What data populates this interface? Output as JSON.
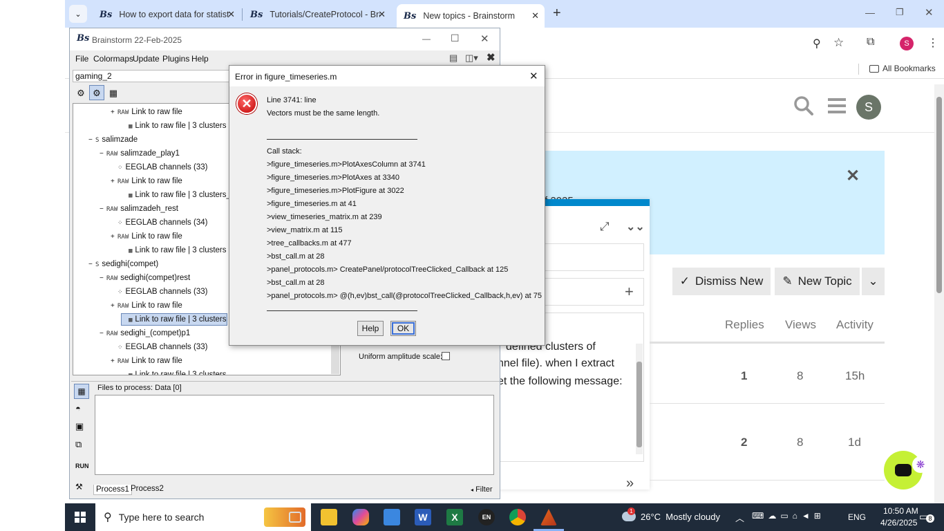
{
  "browser": {
    "tabs": [
      {
        "title": "How to export data for statistic",
        "favicon": "Bs"
      },
      {
        "title": "Tutorials/CreateProtocol - Brain",
        "favicon": "Bs"
      },
      {
        "title": "New topics - Brainstorm",
        "favicon": "Bs"
      }
    ],
    "new_tab": "+",
    "bookmarks_label": "All Bookmarks",
    "profile_initial": "S"
  },
  "forum": {
    "avatar_initial": "S",
    "banner_fragment": "f 2025",
    "dismiss_label": "Dismiss New",
    "new_topic_label": "New Topic",
    "columns": [
      "Replies",
      "Views",
      "Activity"
    ],
    "rows": [
      {
        "replies": "1",
        "views": "8",
        "activity": "15h"
      },
      {
        "replies": "2",
        "views": "8",
        "activity": "1d"
      }
    ],
    "composer_text": [
      "defined clusters of",
      "nnel file). when I extract",
      "et the following message:"
    ],
    "composer_plus": "+"
  },
  "brainstorm": {
    "title": "Brainstorm 22-Feb-2025",
    "menu": [
      "File",
      "Colormaps",
      "Update",
      "Plugins",
      "Help"
    ],
    "protocol": "gaming_2",
    "tree": [
      {
        "indent": 3,
        "icon": "RAW",
        "label": "Link to raw file",
        "expand": "+"
      },
      {
        "indent": 4,
        "icon": "▦",
        "label": "Link to raw file | 3 clusters"
      },
      {
        "indent": 1,
        "icon": "S",
        "label": "salimzade",
        "expand": "−"
      },
      {
        "indent": 2,
        "icon": "RAW",
        "label": "salimzade_play1",
        "expand": "−"
      },
      {
        "indent": 3,
        "icon": "⁘",
        "label": "EEGLAB channels (33)"
      },
      {
        "indent": 3,
        "icon": "RAW",
        "label": "Link to raw file",
        "expand": "+"
      },
      {
        "indent": 4,
        "icon": "▦",
        "label": "Link to raw file | 3 clusters_02"
      },
      {
        "indent": 2,
        "icon": "RAW",
        "label": "salimzadeh_rest",
        "expand": "−"
      },
      {
        "indent": 3,
        "icon": "⁘",
        "label": "EEGLAB channels (34)"
      },
      {
        "indent": 3,
        "icon": "RAW",
        "label": "Link to raw file",
        "expand": "+"
      },
      {
        "indent": 4,
        "icon": "▦",
        "label": "Link to raw file | 3 clusters"
      },
      {
        "indent": 1,
        "icon": "S",
        "label": "sedighi(compet)",
        "expand": "−"
      },
      {
        "indent": 2,
        "icon": "RAW",
        "label": "sedighi(compet)rest",
        "expand": "−"
      },
      {
        "indent": 3,
        "icon": "⁘",
        "label": "EEGLAB channels (33)"
      },
      {
        "indent": 3,
        "icon": "RAW",
        "label": "Link to raw file",
        "expand": "+"
      },
      {
        "indent": 4,
        "icon": "▦",
        "label": "Link to raw file | 3 clusters",
        "selected": true
      },
      {
        "indent": 2,
        "icon": "RAW",
        "label": "sedighi_(compet)p1",
        "expand": "−"
      },
      {
        "indent": 3,
        "icon": "⁘",
        "label": "EEGLAB channels (33)"
      },
      {
        "indent": 3,
        "icon": "RAW",
        "label": "Link to raw file",
        "expand": "+"
      },
      {
        "indent": 4,
        "icon": "▦",
        "label": "Link to raw file | 3 clusters"
      }
    ],
    "uniform_label": "Uniform amplitude scale:",
    "files_label": "Files to process: Data [0]",
    "process_tabs": [
      "Process1",
      "Process2"
    ],
    "filter_label": "Filter",
    "run_label": "RUN"
  },
  "error_dialog": {
    "title": "Error in figure_timeseries.m",
    "lines": [
      "Line 3741: line",
      "Vectors must be the same length.",
      "",
      "Call stack:",
      ">figure_timeseries.m>PlotAxesColumn at 3741",
      ">figure_timeseries.m>PlotAxes at 3340",
      ">figure_timeseries.m>PlotFigure at 3022",
      ">figure_timeseries.m at 41",
      ">view_timeseries_matrix.m at 239",
      ">view_matrix.m at 115",
      ">tree_callbacks.m at 477",
      ">bst_call.m at 28",
      ">panel_protocols.m> CreatePanel/protocolTreeClicked_Callback at 125",
      ">bst_call.m at 28",
      ">panel_protocols.m> @(h,ev)bst_call(@protocolTreeClicked_Callback,h,ev) at 75"
    ],
    "help_label": "Help",
    "ok_label": "OK"
  },
  "taskbar": {
    "search_placeholder": "Type here to search",
    "weather": "26°C  Mostly cloudy",
    "weather_badge": "1",
    "language": "ENG",
    "time": "10:50 AM",
    "date": "4/26/2025",
    "notifications": "8",
    "en_label": "EN"
  }
}
